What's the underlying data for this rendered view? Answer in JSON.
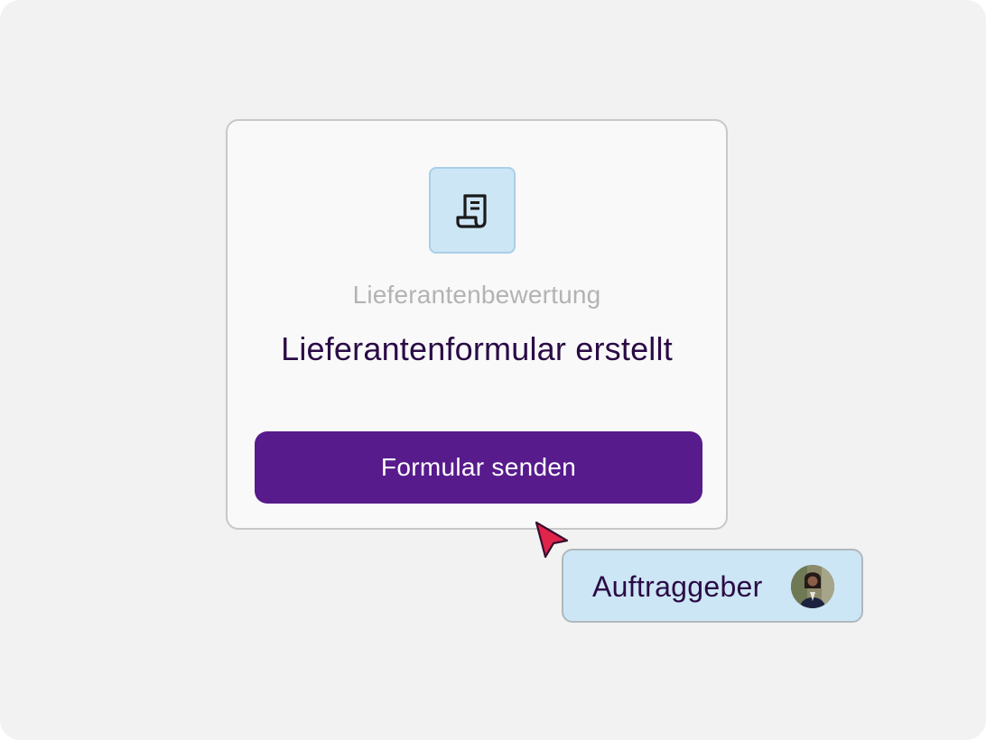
{
  "card": {
    "icon": "receipt-icon",
    "subtitle": "Lieferantenbewertung",
    "title": "Lieferantenformular erstellt",
    "button_label": "Formular senden"
  },
  "cursor": {
    "icon": "pointer-cursor-icon",
    "color": "#e0244a"
  },
  "user_badge": {
    "label": "Auftraggeber",
    "avatar": "avatar"
  },
  "colors": {
    "background": "#f2f2f2",
    "card_background": "#f9f9f9",
    "accent": "#571b8c",
    "icon_tile": "#cde6f5",
    "badge": "#cde6f5",
    "title_text": "#2a0b45",
    "subtitle_text": "#b3b3b3"
  }
}
